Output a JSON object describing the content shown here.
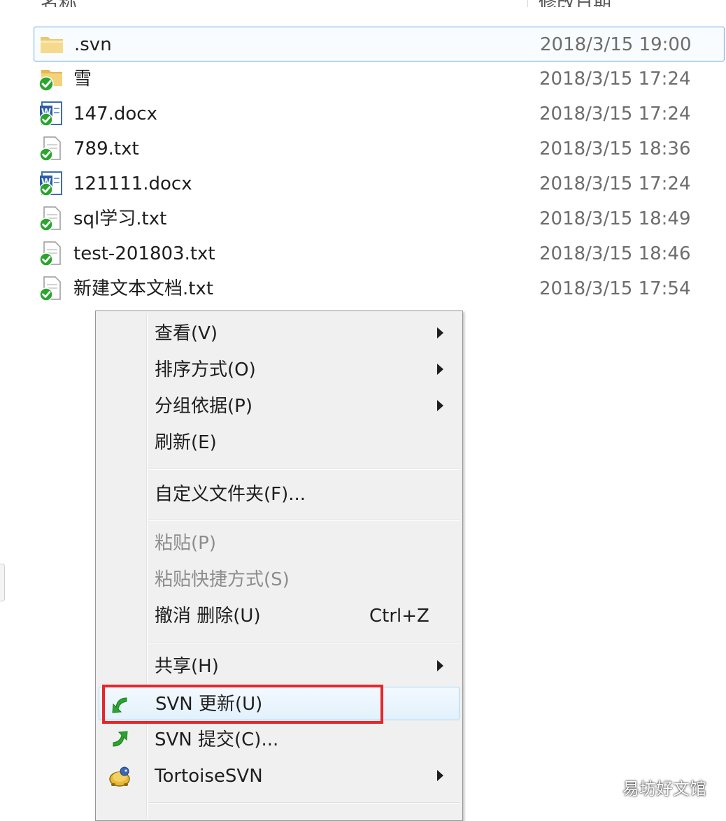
{
  "header": {
    "name_label": "名称",
    "date_label": "修改日期"
  },
  "files": [
    {
      "name": ".svn",
      "date": "2018/3/15 19:00",
      "icon": "folder-icon"
    },
    {
      "name": "雪",
      "date": "2018/3/15 17:24",
      "icon": "svn-folder-icon"
    },
    {
      "name": "147.docx",
      "date": "2018/3/15 17:24",
      "icon": "svn-word-doc-icon"
    },
    {
      "name": "789.txt",
      "date": "2018/3/15 18:36",
      "icon": "svn-text-file-icon"
    },
    {
      "name": "121111.docx",
      "date": "2018/3/15 17:24",
      "icon": "svn-word-doc-icon"
    },
    {
      "name": "sql学习.txt",
      "date": "2018/3/15 18:49",
      "icon": "svn-text-file-icon"
    },
    {
      "name": "test-201803.txt",
      "date": "2018/3/15 18:46",
      "icon": "svn-text-file-icon"
    },
    {
      "name": "新建文本文档.txt",
      "date": "2018/3/15 17:54",
      "icon": "svn-text-file-icon"
    }
  ],
  "menu": {
    "view": "查看(V)",
    "sort": "排序方式(O)",
    "group": "分组依据(P)",
    "refresh": "刷新(E)",
    "customize": "自定义文件夹(F)...",
    "paste": "粘贴(P)",
    "paste_shortcut": "粘贴快捷方式(S)",
    "undo": "撤消 删除(U)",
    "undo_shortcut": "Ctrl+Z",
    "share": "共享(H)",
    "svn_update": "SVN 更新(U)",
    "svn_commit": "SVN 提交(C)...",
    "tortoise": "TortoiseSVN"
  },
  "watermark": "易坊好文馆",
  "colors": {
    "highlight_red": "#e8262a",
    "selection_border": "#7eb4ea",
    "svn_green": "#2aa52e"
  }
}
